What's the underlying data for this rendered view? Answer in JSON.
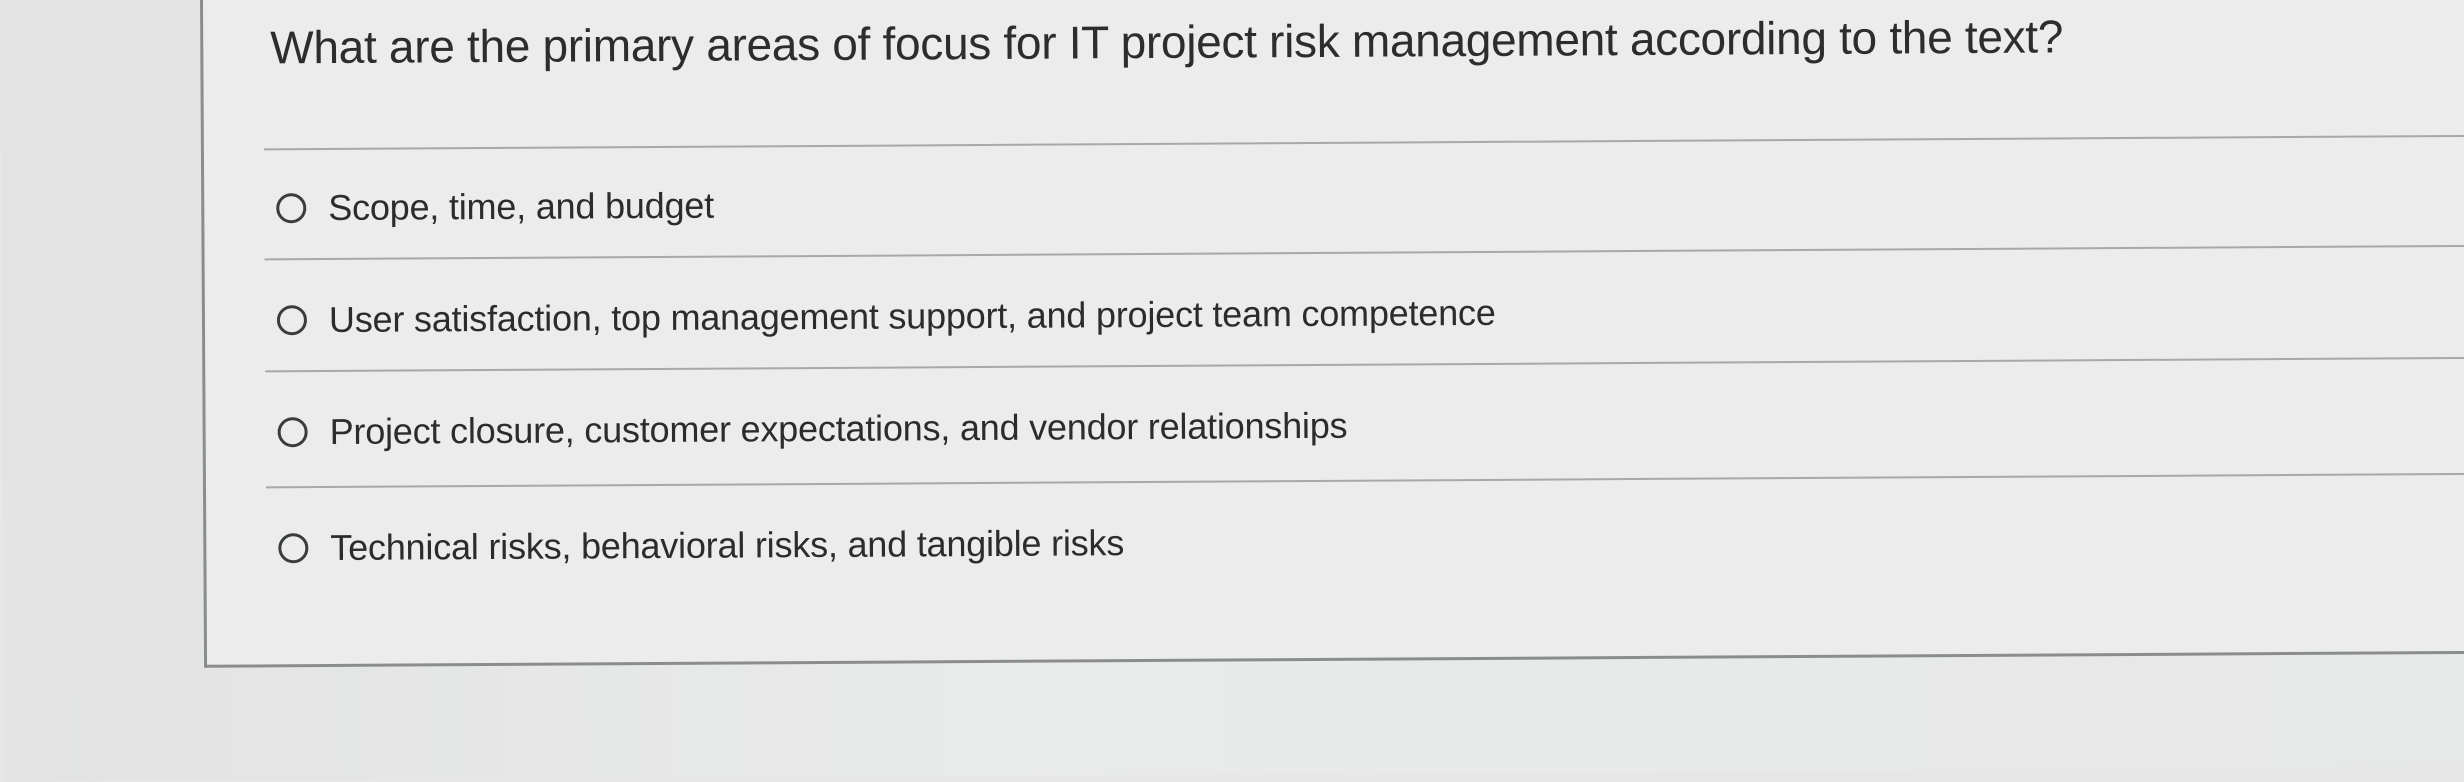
{
  "question": {
    "text": "What are the primary areas of focus for IT project risk management according to the text?"
  },
  "options": [
    {
      "label": "Scope, time, and budget",
      "selected": false
    },
    {
      "label": "User satisfaction, top management support, and project team competence",
      "selected": false
    },
    {
      "label": "Project closure, customer expectations, and vendor relationships",
      "selected": false
    },
    {
      "label": "Technical risks, behavioral risks, and tangible risks",
      "selected": false
    }
  ]
}
